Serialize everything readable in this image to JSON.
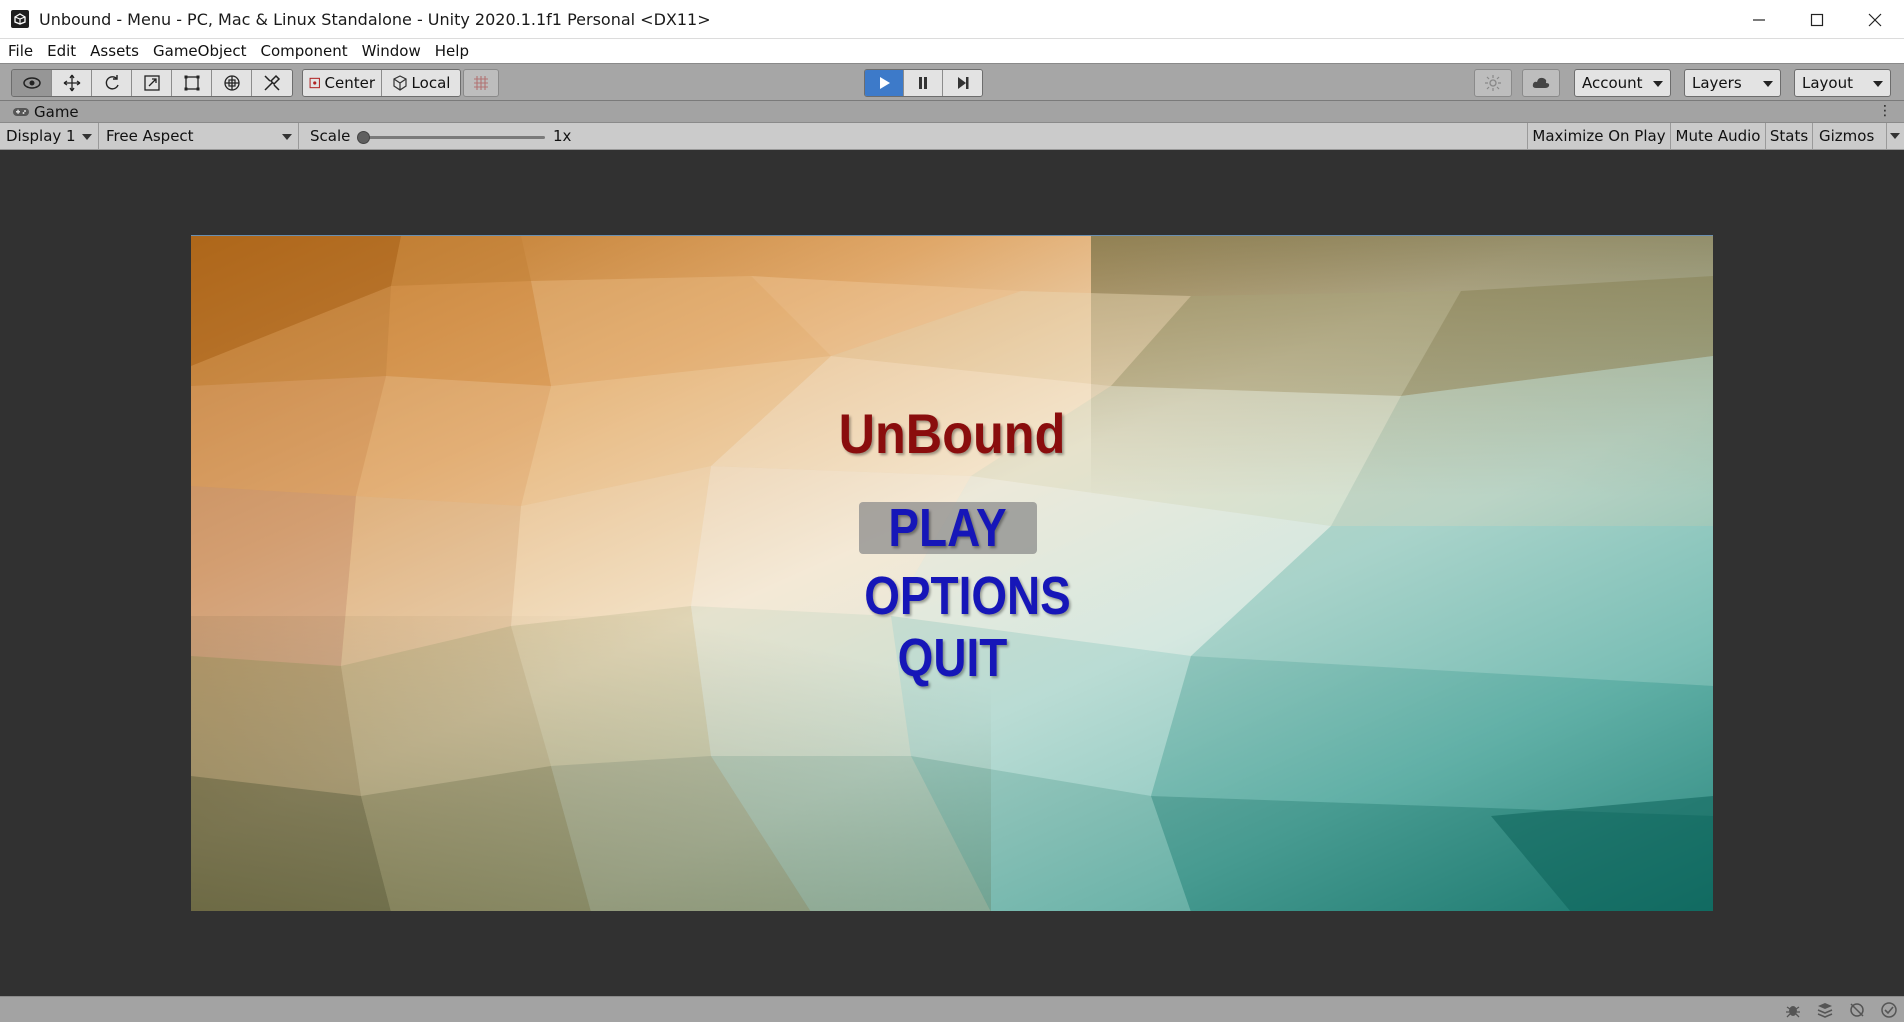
{
  "window": {
    "title": "Unbound - Menu - PC, Mac & Linux Standalone - Unity 2020.1.1f1 Personal <DX11>",
    "app_icon": "unity-icon",
    "controls": [
      "minimize-icon",
      "maximize-icon",
      "close-icon"
    ]
  },
  "menubar": {
    "items": [
      "File",
      "Edit",
      "Assets",
      "GameObject",
      "Component",
      "Window",
      "Help"
    ]
  },
  "toolbar": {
    "tools": [
      "view-eye-icon",
      "move-icon",
      "rotate-icon",
      "scale-icon",
      "rect-transform-icon",
      "transform-icon",
      "custom-tool-icon"
    ],
    "pivot_center": "Center",
    "pivot_local": "Local",
    "snap_icon": "grid-snap-icon",
    "play_controls": [
      "play-icon",
      "pause-icon",
      "step-icon"
    ],
    "collab_icon": "collab-icon",
    "cloud_icon": "cloud-icon",
    "account": "Account",
    "layers": "Layers",
    "layout": "Layout"
  },
  "game_tab": {
    "label": "Game",
    "icon": "gamepad-icon"
  },
  "game_controls": {
    "display": "Display 1",
    "aspect": "Free Aspect",
    "scale_label": "Scale",
    "scale_value": "1x",
    "scale_fraction": 0.0,
    "maximize_on_play": "Maximize On Play",
    "mute_audio": "Mute Audio",
    "stats": "Stats",
    "gizmos": "Gizmos"
  },
  "game_view": {
    "title": "UnBound",
    "play": "PLAY",
    "options": "OPTIONS",
    "quit": "QUIT",
    "colors": {
      "title": "#8a0d0d",
      "buttons": "#1616b8",
      "play_highlight": "#8c8c8c"
    }
  },
  "statusbar": {
    "icons": [
      "bug-icon",
      "layers-stack-icon",
      "visibility-icon",
      "checkmark-icon"
    ]
  },
  "colors": {
    "play_active": "#3d7ac9",
    "toolbar_bg": "#a6a6a6",
    "viewport_bg": "#313131"
  }
}
